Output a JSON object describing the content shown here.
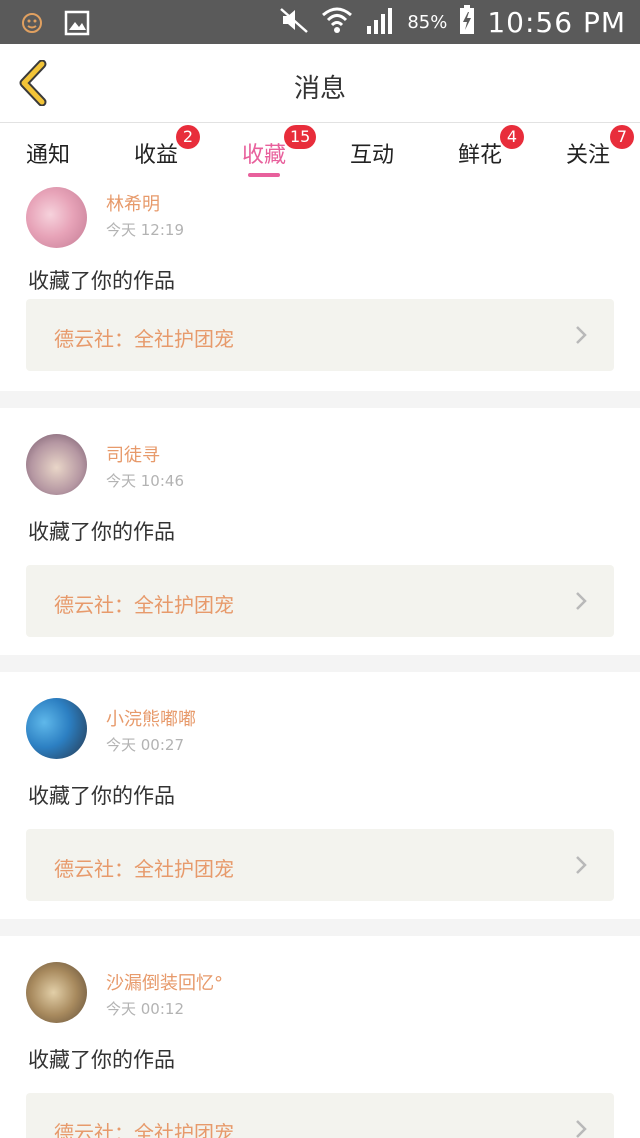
{
  "status_bar": {
    "battery_percent": "85%",
    "time": "10:56 PM",
    "icons": [
      "notification-face-icon",
      "gallery-icon",
      "mute-icon",
      "wifi-icon",
      "signal-icon",
      "battery-charging-icon"
    ]
  },
  "header": {
    "title": "消息",
    "back_icon": "chevron-left-icon",
    "back_color": "#f2c438"
  },
  "tabs": [
    {
      "label": "通知",
      "badge": ""
    },
    {
      "label": "收益",
      "badge": "2"
    },
    {
      "label": "收藏",
      "badge": "15",
      "active": true
    },
    {
      "label": "互动",
      "badge": ""
    },
    {
      "label": "鲜花",
      "badge": "4"
    },
    {
      "label": "关注",
      "badge": "7"
    }
  ],
  "colors": {
    "accent": "#e8609c",
    "badge": "#e82d3b",
    "username": "#e79a6b",
    "work_title": "#e79a6b"
  },
  "notifications": [
    {
      "user": "林希明",
      "time": "今天 12:19",
      "action": "收藏了你的作品",
      "work": "德云社：全社护团宠"
    },
    {
      "user": "司徒寻",
      "time": "今天 10:46",
      "action": "收藏了你的作品",
      "work": "德云社：全社护团宠"
    },
    {
      "user": "小浣熊嘟嘟",
      "time": "今天 00:27",
      "action": "收藏了你的作品",
      "work": "德云社：全社护团宠"
    },
    {
      "user": "沙漏倒装回忆°",
      "time": "今天 00:12",
      "action": "收藏了你的作品",
      "work": "德云社：全社护团宠"
    }
  ]
}
